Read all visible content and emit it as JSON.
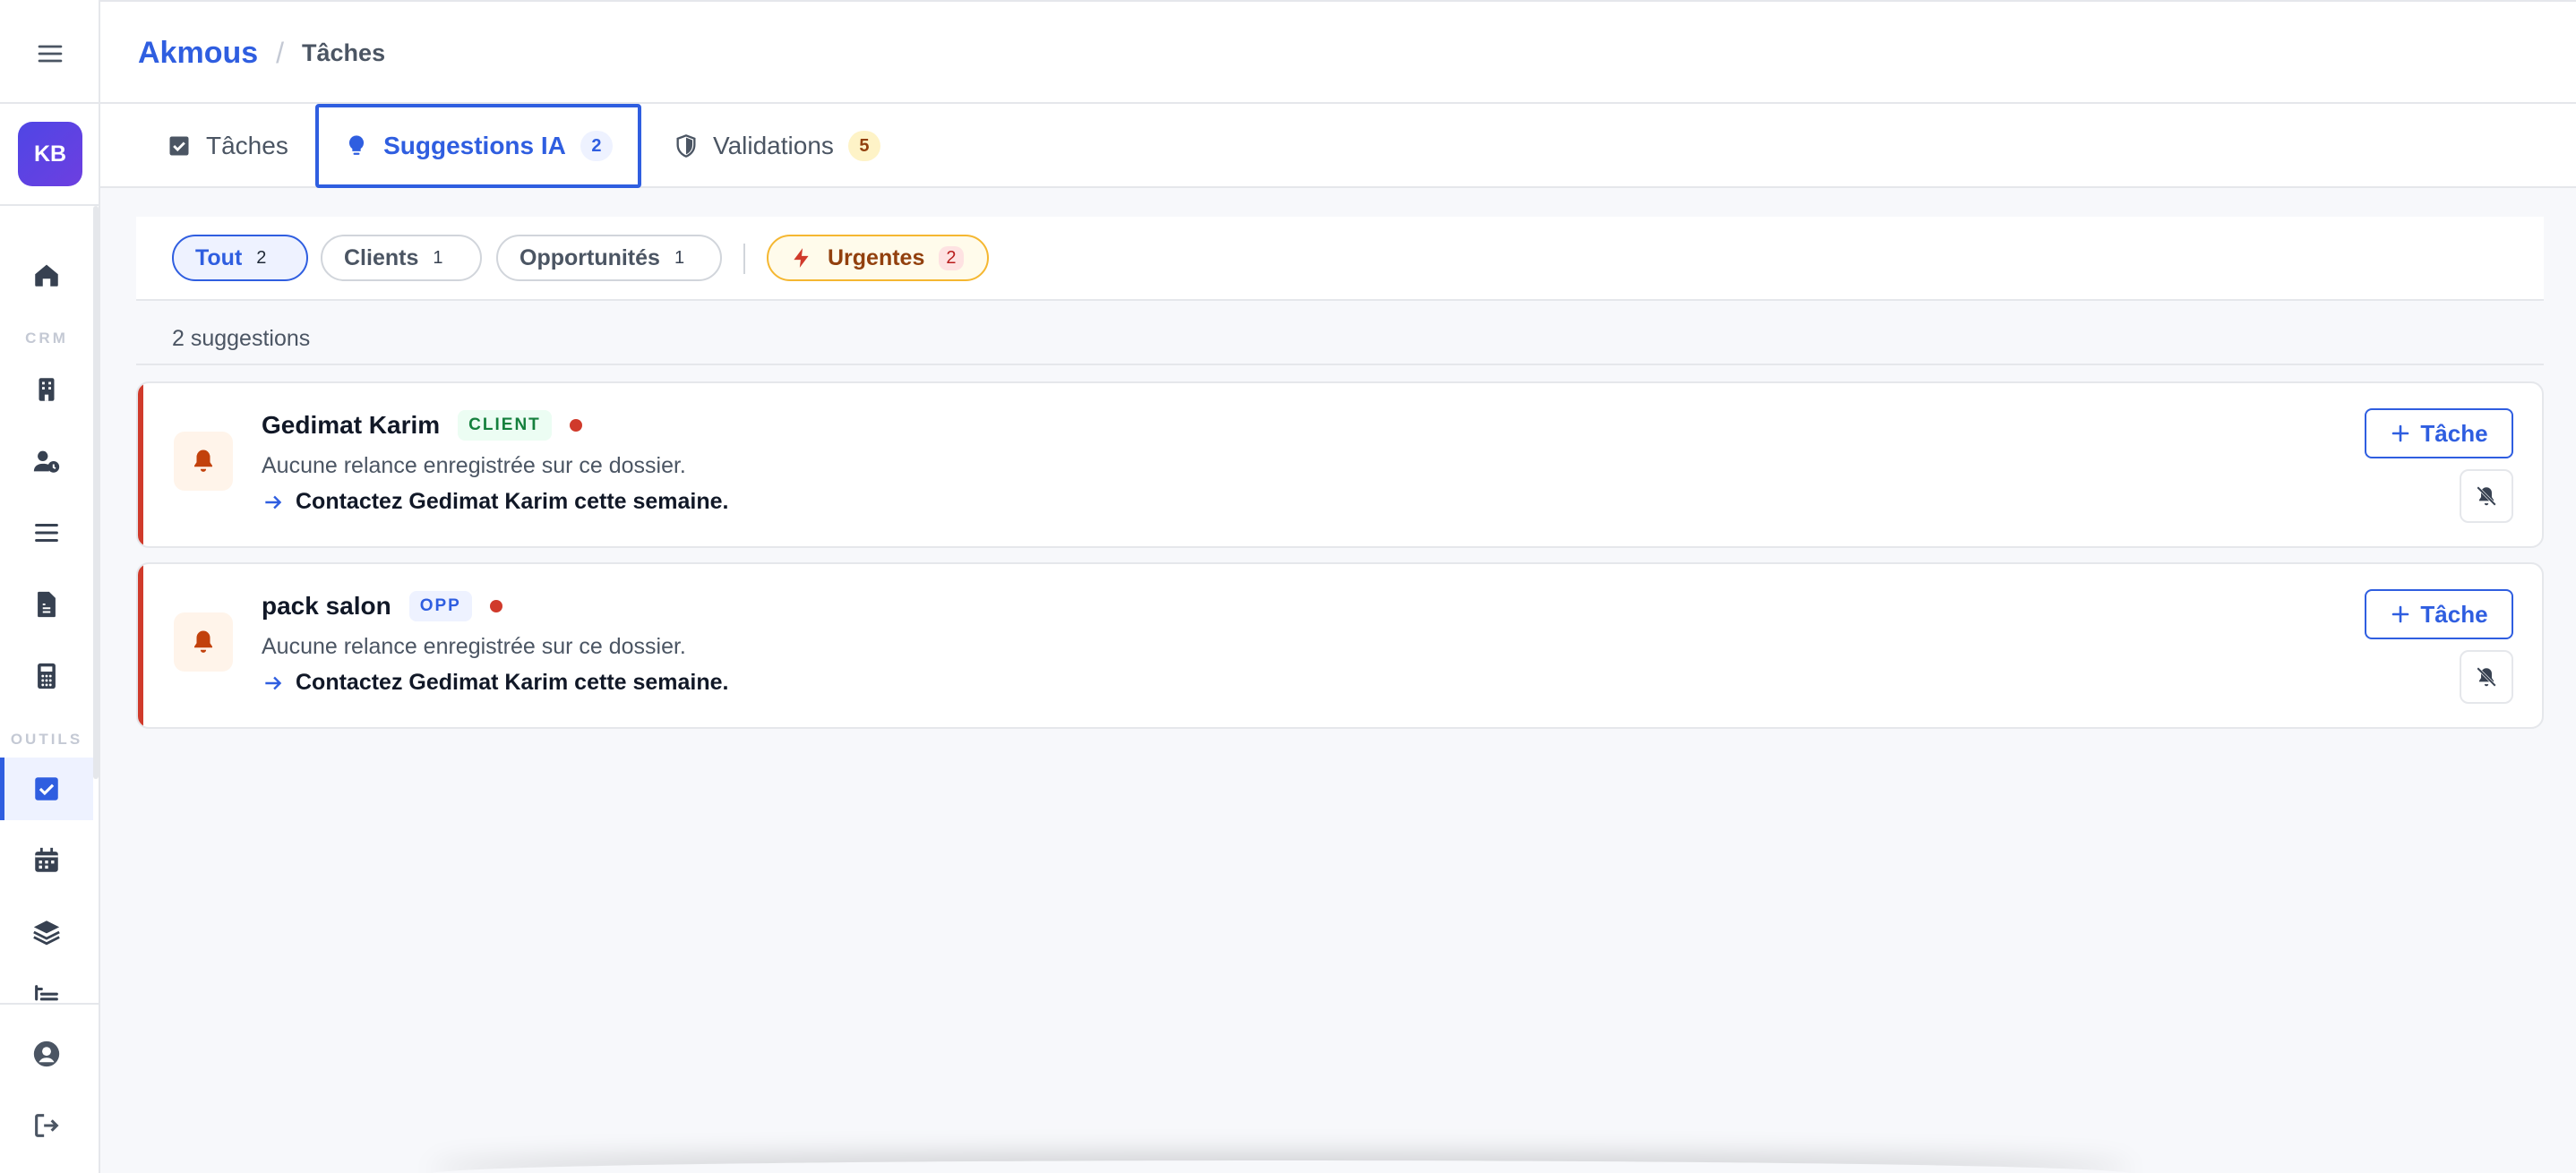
{
  "breadcrumb": {
    "brand": "Akmous",
    "separator": "/",
    "page": "Tâches"
  },
  "user": {
    "initials": "KB"
  },
  "sidebar": {
    "sections": {
      "crm": "CRM",
      "tools": "OUTILS"
    },
    "icons": [
      "home-icon",
      "building-icon",
      "user-clock-icon",
      "list-icon",
      "file-invoice-icon",
      "calculator-icon",
      "checkbox-icon",
      "calendar-icon",
      "layers-icon",
      "list-tree-icon",
      "user-circle-icon",
      "logout-icon"
    ]
  },
  "tabs": [
    {
      "label": "Tâches",
      "count": "",
      "icon": "checkbox-icon"
    },
    {
      "label": "Suggestions IA",
      "count": "2",
      "icon": "lightbulb-icon"
    },
    {
      "label": "Validations",
      "count": "5",
      "icon": "shield-icon"
    }
  ],
  "filters": [
    {
      "label": "Tout",
      "count": "2"
    },
    {
      "label": "Clients",
      "count": "1"
    },
    {
      "label": "Opportunités",
      "count": "1"
    },
    {
      "label": "Urgentes",
      "count": "2"
    }
  ],
  "suggestions_count": "2 suggestions",
  "cards": [
    {
      "name": "Gedimat Karim",
      "badge": "CLIENT",
      "description": "Aucune relance enregistrée sur ce dossier.",
      "action": "Contactez Gedimat Karim cette semaine.",
      "task_button": "Tâche"
    },
    {
      "name": "pack salon",
      "badge": "OPP",
      "description": "Aucune relance enregistrée sur ce dossier.",
      "action": "Contactez Gedimat Karim cette semaine.",
      "task_button": "Tâche"
    }
  ],
  "colors": {
    "accent": "#2f5ee0",
    "urgent": "#d03a2b",
    "avatar": "#4f46e5"
  }
}
